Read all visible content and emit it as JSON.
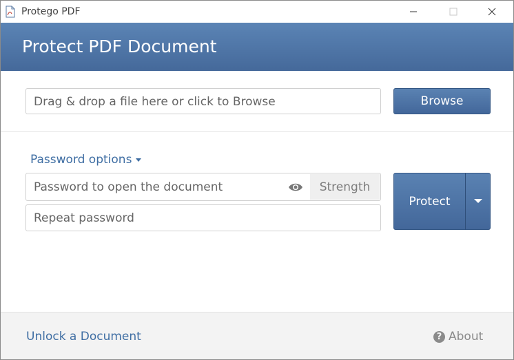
{
  "window": {
    "title": "Protego PDF",
    "icon": "pdf-document-icon"
  },
  "header": {
    "title": "Protect PDF Document"
  },
  "file": {
    "placeholder": "Drag & drop a file here or click to Browse",
    "browse_label": "Browse"
  },
  "password": {
    "options_label": "Password options",
    "open_placeholder": "Password to open the document",
    "strength_label": "Strength",
    "repeat_placeholder": "Repeat password",
    "eye_icon": "eye-icon"
  },
  "actions": {
    "protect_label": "Protect",
    "dropdown_icon": "chevron-down-icon"
  },
  "footer": {
    "unlock_label": "Unlock a Document",
    "about_label": "About",
    "help_icon": "question-circle-icon",
    "help_glyph": "?"
  },
  "colors": {
    "accent": "#4a6fa0",
    "link": "#3f6ea3"
  }
}
